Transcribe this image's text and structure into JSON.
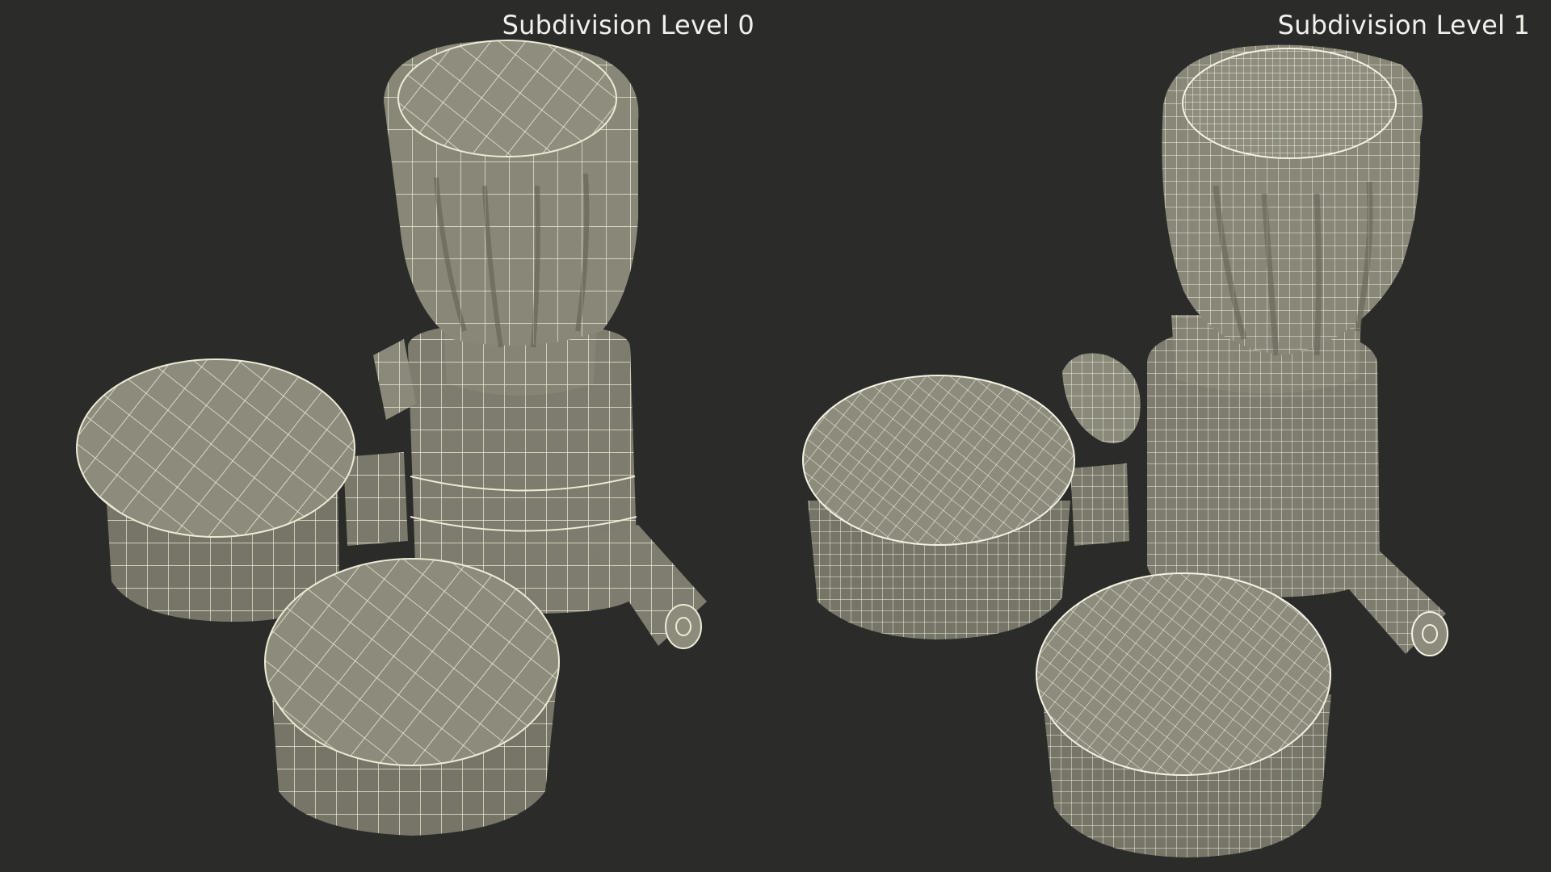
{
  "labels": {
    "left": "Subdivision Level 0",
    "right": "Subdivision Level 1"
  },
  "colors": {
    "background": "#2b2b2a",
    "surface": "#8c8b7c",
    "surface_dark": "#6e6d60",
    "wire_level0": "#ecebd6",
    "wire_level1": "#f3f2e4",
    "label_text": "#f1f1ec"
  }
}
